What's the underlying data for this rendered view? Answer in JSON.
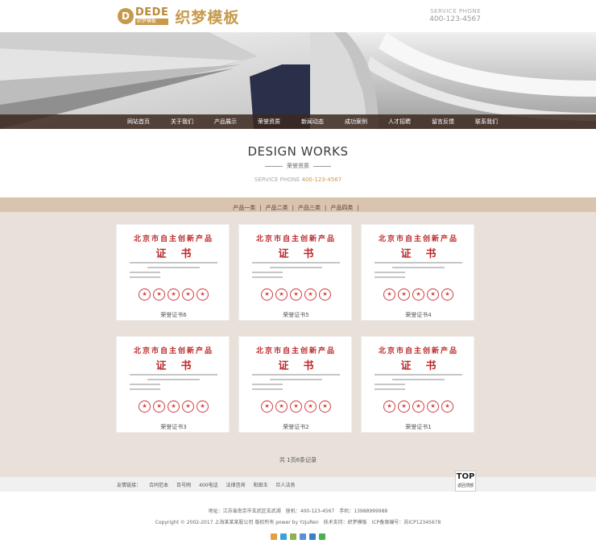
{
  "header": {
    "logo_badge": "D",
    "logo_en": "DEDE",
    "logo_en_sub": "织梦模板",
    "logo_cn": "织梦模板",
    "service_label": "SERVICE PHONE",
    "service_phone": "400-123-4567"
  },
  "nav": {
    "items": [
      "网站首页",
      "关于我们",
      "产品展示",
      "荣誉资质",
      "新闻动态",
      "成功案例",
      "人才招聘",
      "留言反馈",
      "联系我们"
    ],
    "active_index": 3
  },
  "section": {
    "title_en": "DESIGN WORKS",
    "title_cn": "荣誉资质",
    "service_prefix": "SERVICE PHONE ",
    "service_phone": "400-123-4567"
  },
  "categories": [
    "产品一类",
    "产品二类",
    "产品三类",
    "产品四类"
  ],
  "certificate": {
    "title": "北京市自主创新产品",
    "word": "证书"
  },
  "cards": [
    {
      "caption": "荣誉证书6"
    },
    {
      "caption": "荣誉证书5"
    },
    {
      "caption": "荣誉证书4"
    },
    {
      "caption": "荣誉证书3"
    },
    {
      "caption": "荣誉证书2"
    },
    {
      "caption": "荣誉证书1"
    }
  ],
  "pager": "共 1页6条记录",
  "friend_links": {
    "label": "友情链接：",
    "items": [
      "合同范本",
      "百号网",
      "400电话",
      "法律咨询",
      "和田玉",
      "巨人法务"
    ]
  },
  "top_button": {
    "label": "TOP",
    "sub": "返回顶部"
  },
  "footer": {
    "address_line": "地址：江苏省南京市玄武区玄武湖　座机：400-123-4567　手机：13988999988",
    "copyright_line": "Copyright © 2002-2017 上海某某某股公司 版权所有 power by YzjuRen　技术支持：织梦模板　ICP备案编号：苏ICP12345678"
  },
  "colors": {
    "brand_gold": "#c69a4b",
    "nav_bg": "#3c281e",
    "catbar_bg": "#d9c4b0",
    "main_bg": "#e8e0d9",
    "cert_red": "#c0282a"
  }
}
